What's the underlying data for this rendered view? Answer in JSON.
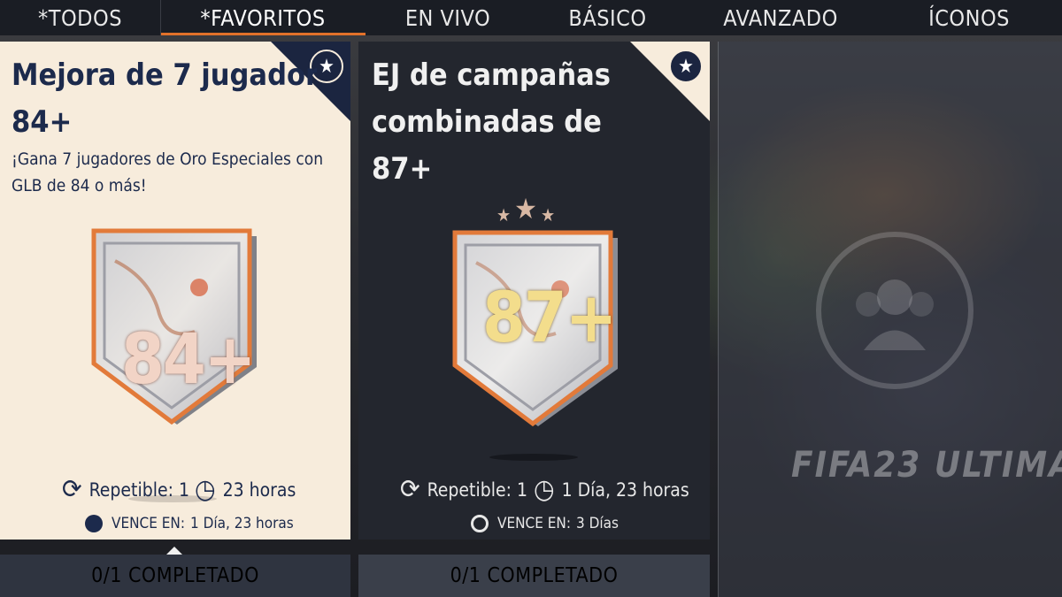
{
  "tabs": [
    {
      "label": "*TODOS"
    },
    {
      "label": "*FAVORITOS"
    },
    {
      "label": "EN VIVO"
    },
    {
      "label": "BÁSICO"
    },
    {
      "label": "AVANZADO"
    },
    {
      "label": "ÍCONOS"
    }
  ],
  "active_tab": "*FAVORITOS",
  "cards": [
    {
      "title_line1": "Mejora de 7 jugadores de",
      "title_line2": "84+",
      "description": "¡Gana 7 jugadores de Oro Especiales con GLB de 84 o más!",
      "rating": "84+",
      "repeatable": "Repetible: 1",
      "time_left": "23 horas",
      "expires_label": "VENCE EN:",
      "expires_value": "1 Día, 23 horas",
      "footer": "0/1 COMPLETADO",
      "favorite_icon": "star-icon"
    },
    {
      "title": "EJ de campañas combinadas de 87+",
      "rating": "87+",
      "repeatable": "Repetible: 1",
      "time_left": "1 Día, 23 horas",
      "expires_label": "VENCE EN:",
      "expires_value": "3 Días",
      "footer": "0/1 COMPLETADO",
      "favorite_icon": "star-icon"
    },
    {
      "background_text": "FIFA23 ULTIMA"
    }
  ],
  "colors": {
    "accent_orange": "#e2712a",
    "card_light_bg": "#f7ecdc",
    "card_dark_bg": "#23262e",
    "title_navy": "#1c2a4c",
    "rating_light": "#f2d4c6",
    "rating_gold": "#f3dd8c"
  }
}
